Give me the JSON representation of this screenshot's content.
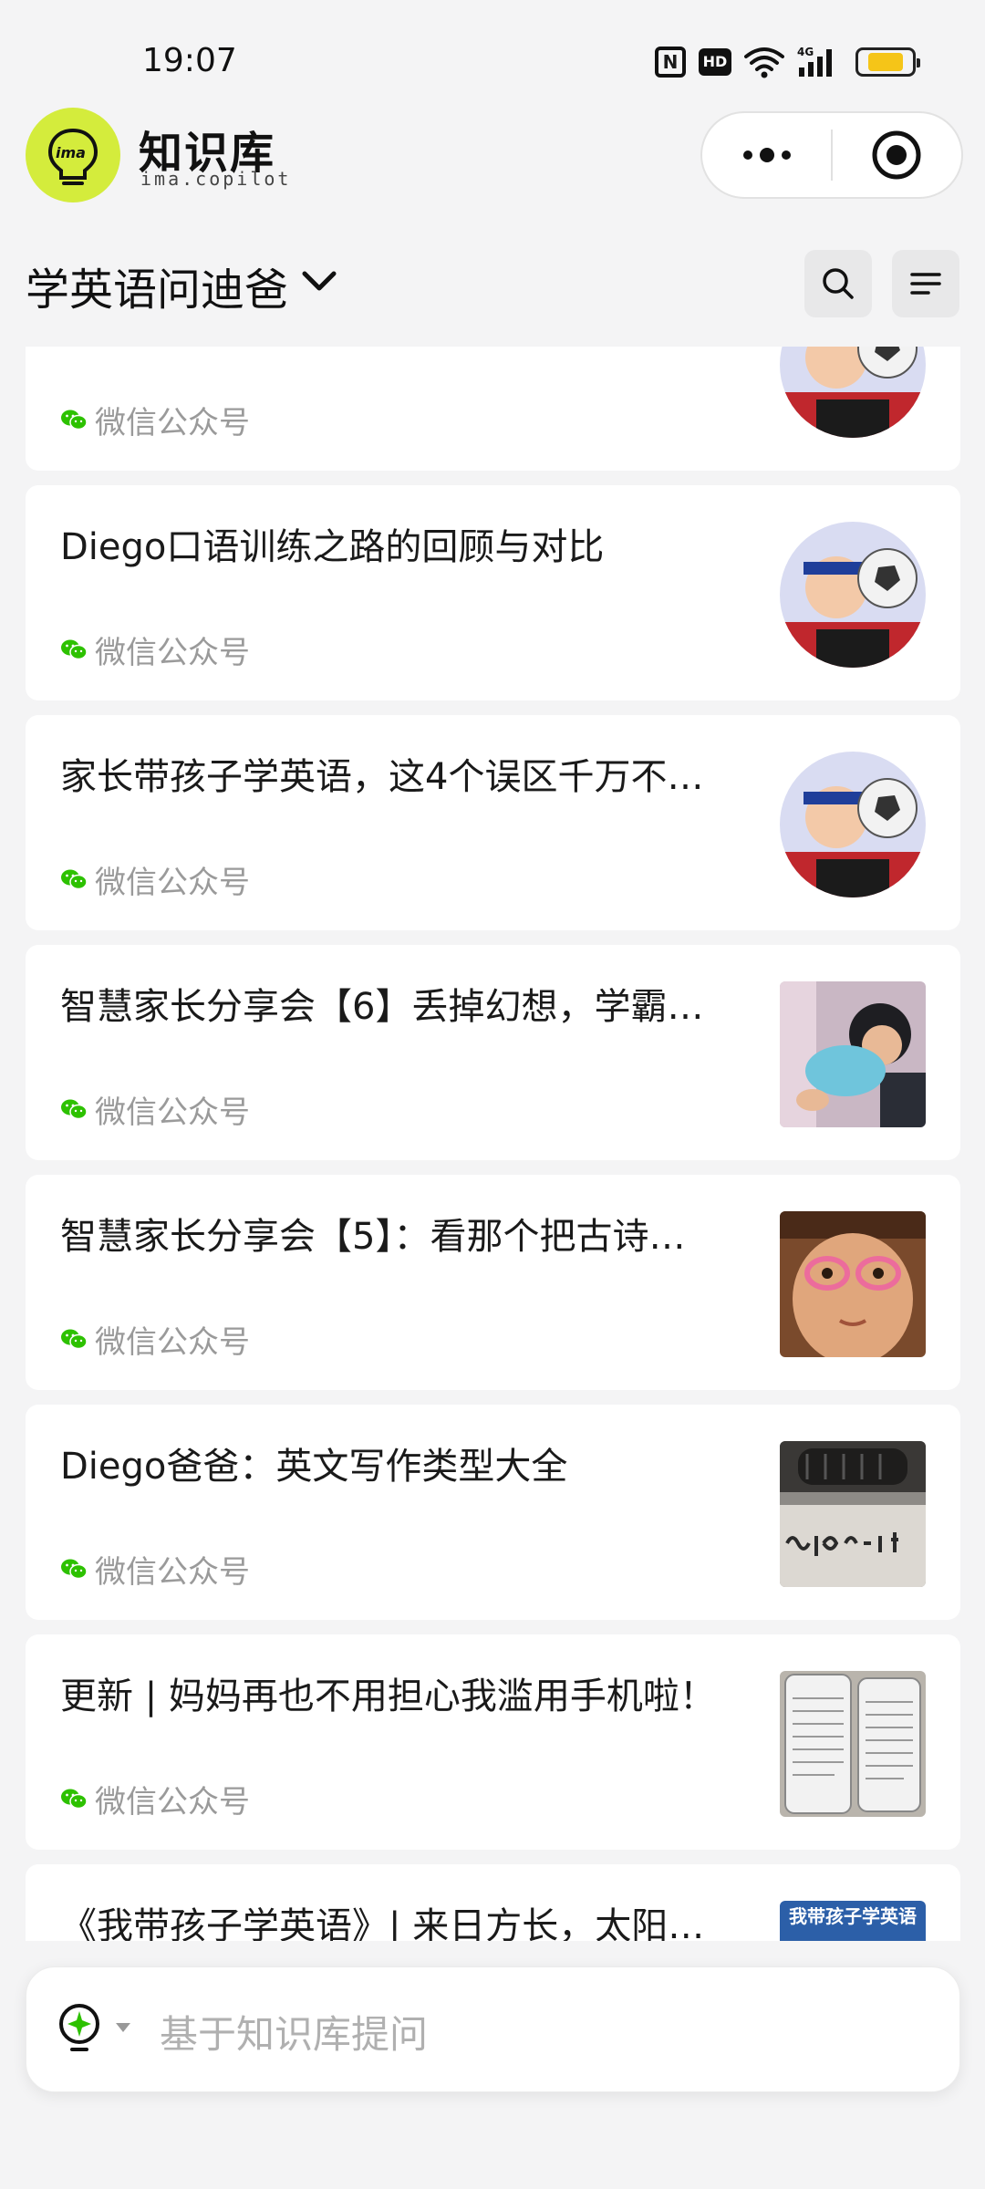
{
  "status_bar": {
    "time": "19:07",
    "nfc_label": "N",
    "hd_label": "HD",
    "network_label": "4G",
    "battery_level": 0.7,
    "battery_color": "#f5c518"
  },
  "header": {
    "logo_mark": "ima",
    "title": "知识库",
    "subtitle": "ima.copilot",
    "logo_color": "#d4ec3c"
  },
  "knowledge_base": {
    "name": "学英语问迪爸"
  },
  "cards": [
    {
      "title": "",
      "source": "微信公众号",
      "thumb": "avatar-boy"
    },
    {
      "title": "Diego口语训练之路的回顾与对比",
      "source": "微信公众号",
      "thumb": "avatar-boy"
    },
    {
      "title": "家长带孩子学英语，这4个误区千万不…",
      "source": "微信公众号",
      "thumb": "avatar-boy"
    },
    {
      "title": "智慧家长分享会【6】丢掉幻想，学霸…",
      "source": "微信公众号",
      "thumb": "photo-toddler"
    },
    {
      "title": "智慧家长分享会【5】：看那个把古诗…",
      "source": "微信公众号",
      "thumb": "photo-girl"
    },
    {
      "title": "Diego爸爸：英文写作类型大全",
      "source": "微信公众号",
      "thumb": "photo-typewriter"
    },
    {
      "title": "更新 | 妈妈再也不用担心我滥用手机啦！",
      "source": "微信公众号",
      "thumb": "photo-documents"
    },
    {
      "title": "《我带孩子学英语》| 来日方长，太阳…",
      "source": "",
      "thumb": "photo-book",
      "thumb_text": "我带孩子学英语"
    }
  ],
  "ask_bar": {
    "placeholder": "基于知识库提问"
  },
  "colors": {
    "wechat_green": "#2dc100",
    "accent": "#d4ec3c"
  }
}
